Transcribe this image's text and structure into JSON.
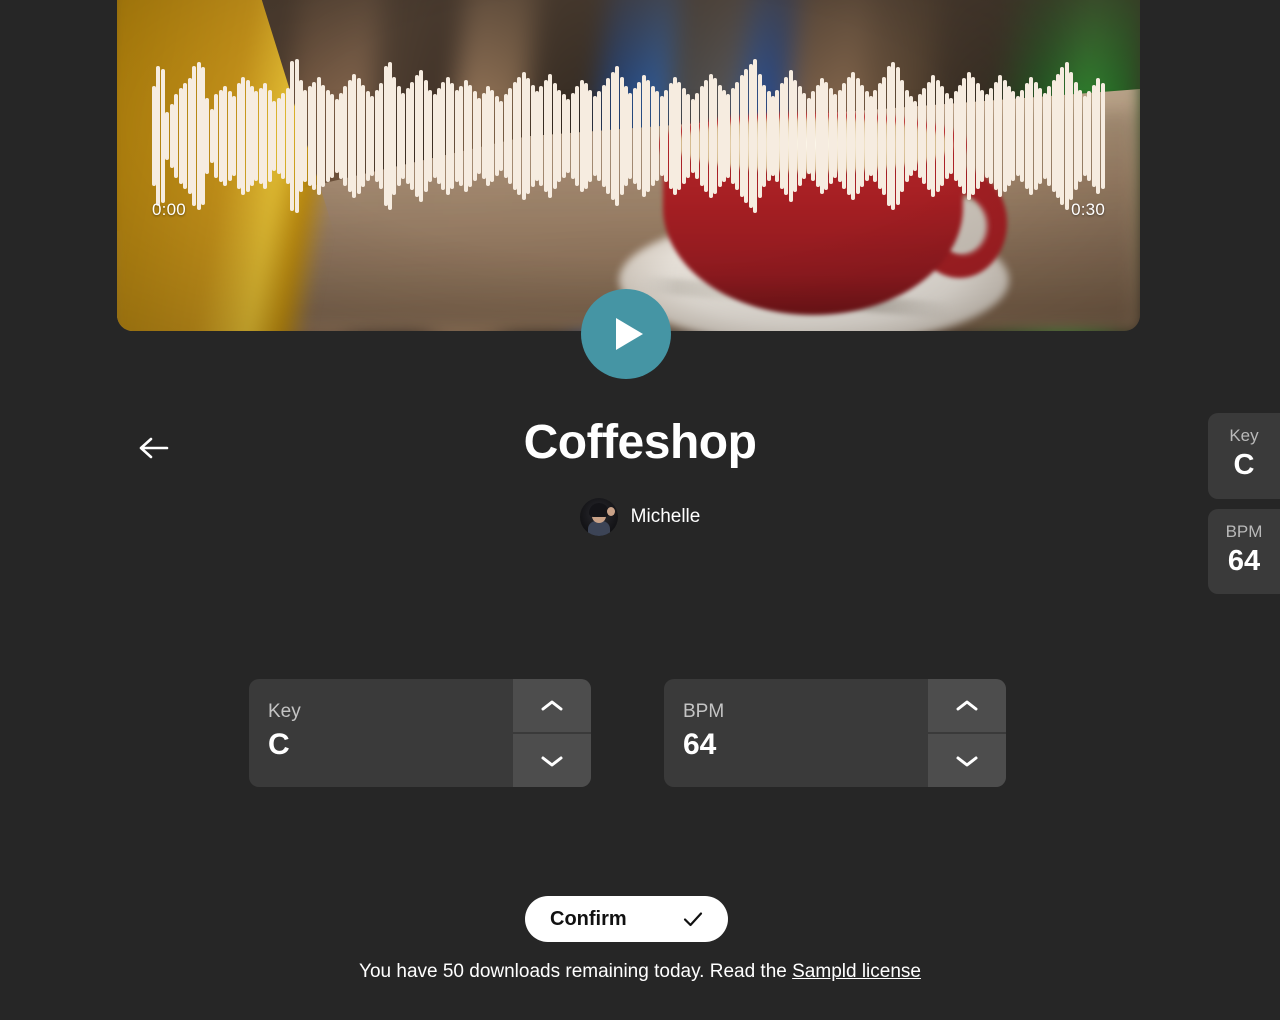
{
  "player": {
    "time_start": "0:00",
    "time_end": "0:30",
    "play_icon": "play-triangle-icon",
    "accent_color": "#4595a4",
    "waveform_color": "#f6ece0",
    "waveform_amplitudes": [
      62,
      88,
      84,
      30,
      40,
      52,
      60,
      66,
      72,
      88,
      92,
      86,
      48,
      34,
      52,
      58,
      62,
      56,
      50,
      66,
      74,
      70,
      62,
      56,
      60,
      66,
      58,
      44,
      48,
      54,
      60,
      94,
      96,
      70,
      58,
      62,
      68,
      74,
      64,
      58,
      52,
      46,
      54,
      62,
      70,
      78,
      72,
      64,
      56,
      50,
      58,
      66,
      88,
      92,
      74,
      62,
      54,
      60,
      68,
      76,
      82,
      70,
      58,
      52,
      60,
      68,
      74,
      66,
      58,
      62,
      70,
      64,
      56,
      48,
      54,
      62,
      58,
      50,
      44,
      52,
      60,
      68,
      74,
      80,
      72,
      64,
      56,
      62,
      70,
      78,
      66,
      58,
      52,
      46,
      54,
      62,
      70,
      66,
      58,
      50,
      56,
      64,
      72,
      80,
      88,
      74,
      62,
      54,
      60,
      68,
      76,
      70,
      62,
      56,
      50,
      58,
      66,
      74,
      68,
      60,
      52,
      46,
      54,
      62,
      70,
      78,
      72,
      64,
      58,
      52,
      60,
      68,
      76,
      84,
      90,
      96,
      78,
      64,
      56,
      50,
      58,
      66,
      74,
      82,
      70,
      62,
      54,
      48,
      56,
      64,
      72,
      68,
      60,
      52,
      58,
      66,
      74,
      80,
      72,
      64,
      56,
      50,
      58,
      66,
      74,
      88,
      92,
      86,
      70,
      58,
      50,
      44,
      52,
      60,
      68,
      76,
      70,
      62,
      54,
      48,
      56,
      64,
      72,
      80,
      74,
      66,
      58,
      52,
      60,
      68,
      76,
      70,
      62,
      56,
      50,
      58,
      66,
      74,
      68,
      60,
      54,
      62,
      70,
      78,
      86,
      92,
      80,
      68,
      58,
      50,
      56,
      64,
      72,
      66
    ]
  },
  "header": {
    "back_icon": "arrow-left-icon",
    "title": "Coffeshop",
    "artist": "Michelle",
    "avatar_icon": "user-avatar-icon"
  },
  "side_badges": [
    {
      "label": "Key",
      "value": "C"
    },
    {
      "label": "BPM",
      "value": "64"
    }
  ],
  "steppers": [
    {
      "label": "Key",
      "value": "C",
      "increment_icon": "chevron-up-icon",
      "decrement_icon": "chevron-down-icon"
    },
    {
      "label": "BPM",
      "value": "64",
      "increment_icon": "chevron-up-icon",
      "decrement_icon": "chevron-down-icon"
    }
  ],
  "confirm": {
    "label": "Confirm",
    "check_icon": "check-icon"
  },
  "footer": {
    "text": "You have 50 downloads remaining today. Read the ",
    "link": "Sampld license"
  },
  "colors": {
    "background": "#262626",
    "panel": "#3a3a3a",
    "panel_light": "#4d4d4d",
    "accent": "#4595a4",
    "text": "#ffffff"
  }
}
